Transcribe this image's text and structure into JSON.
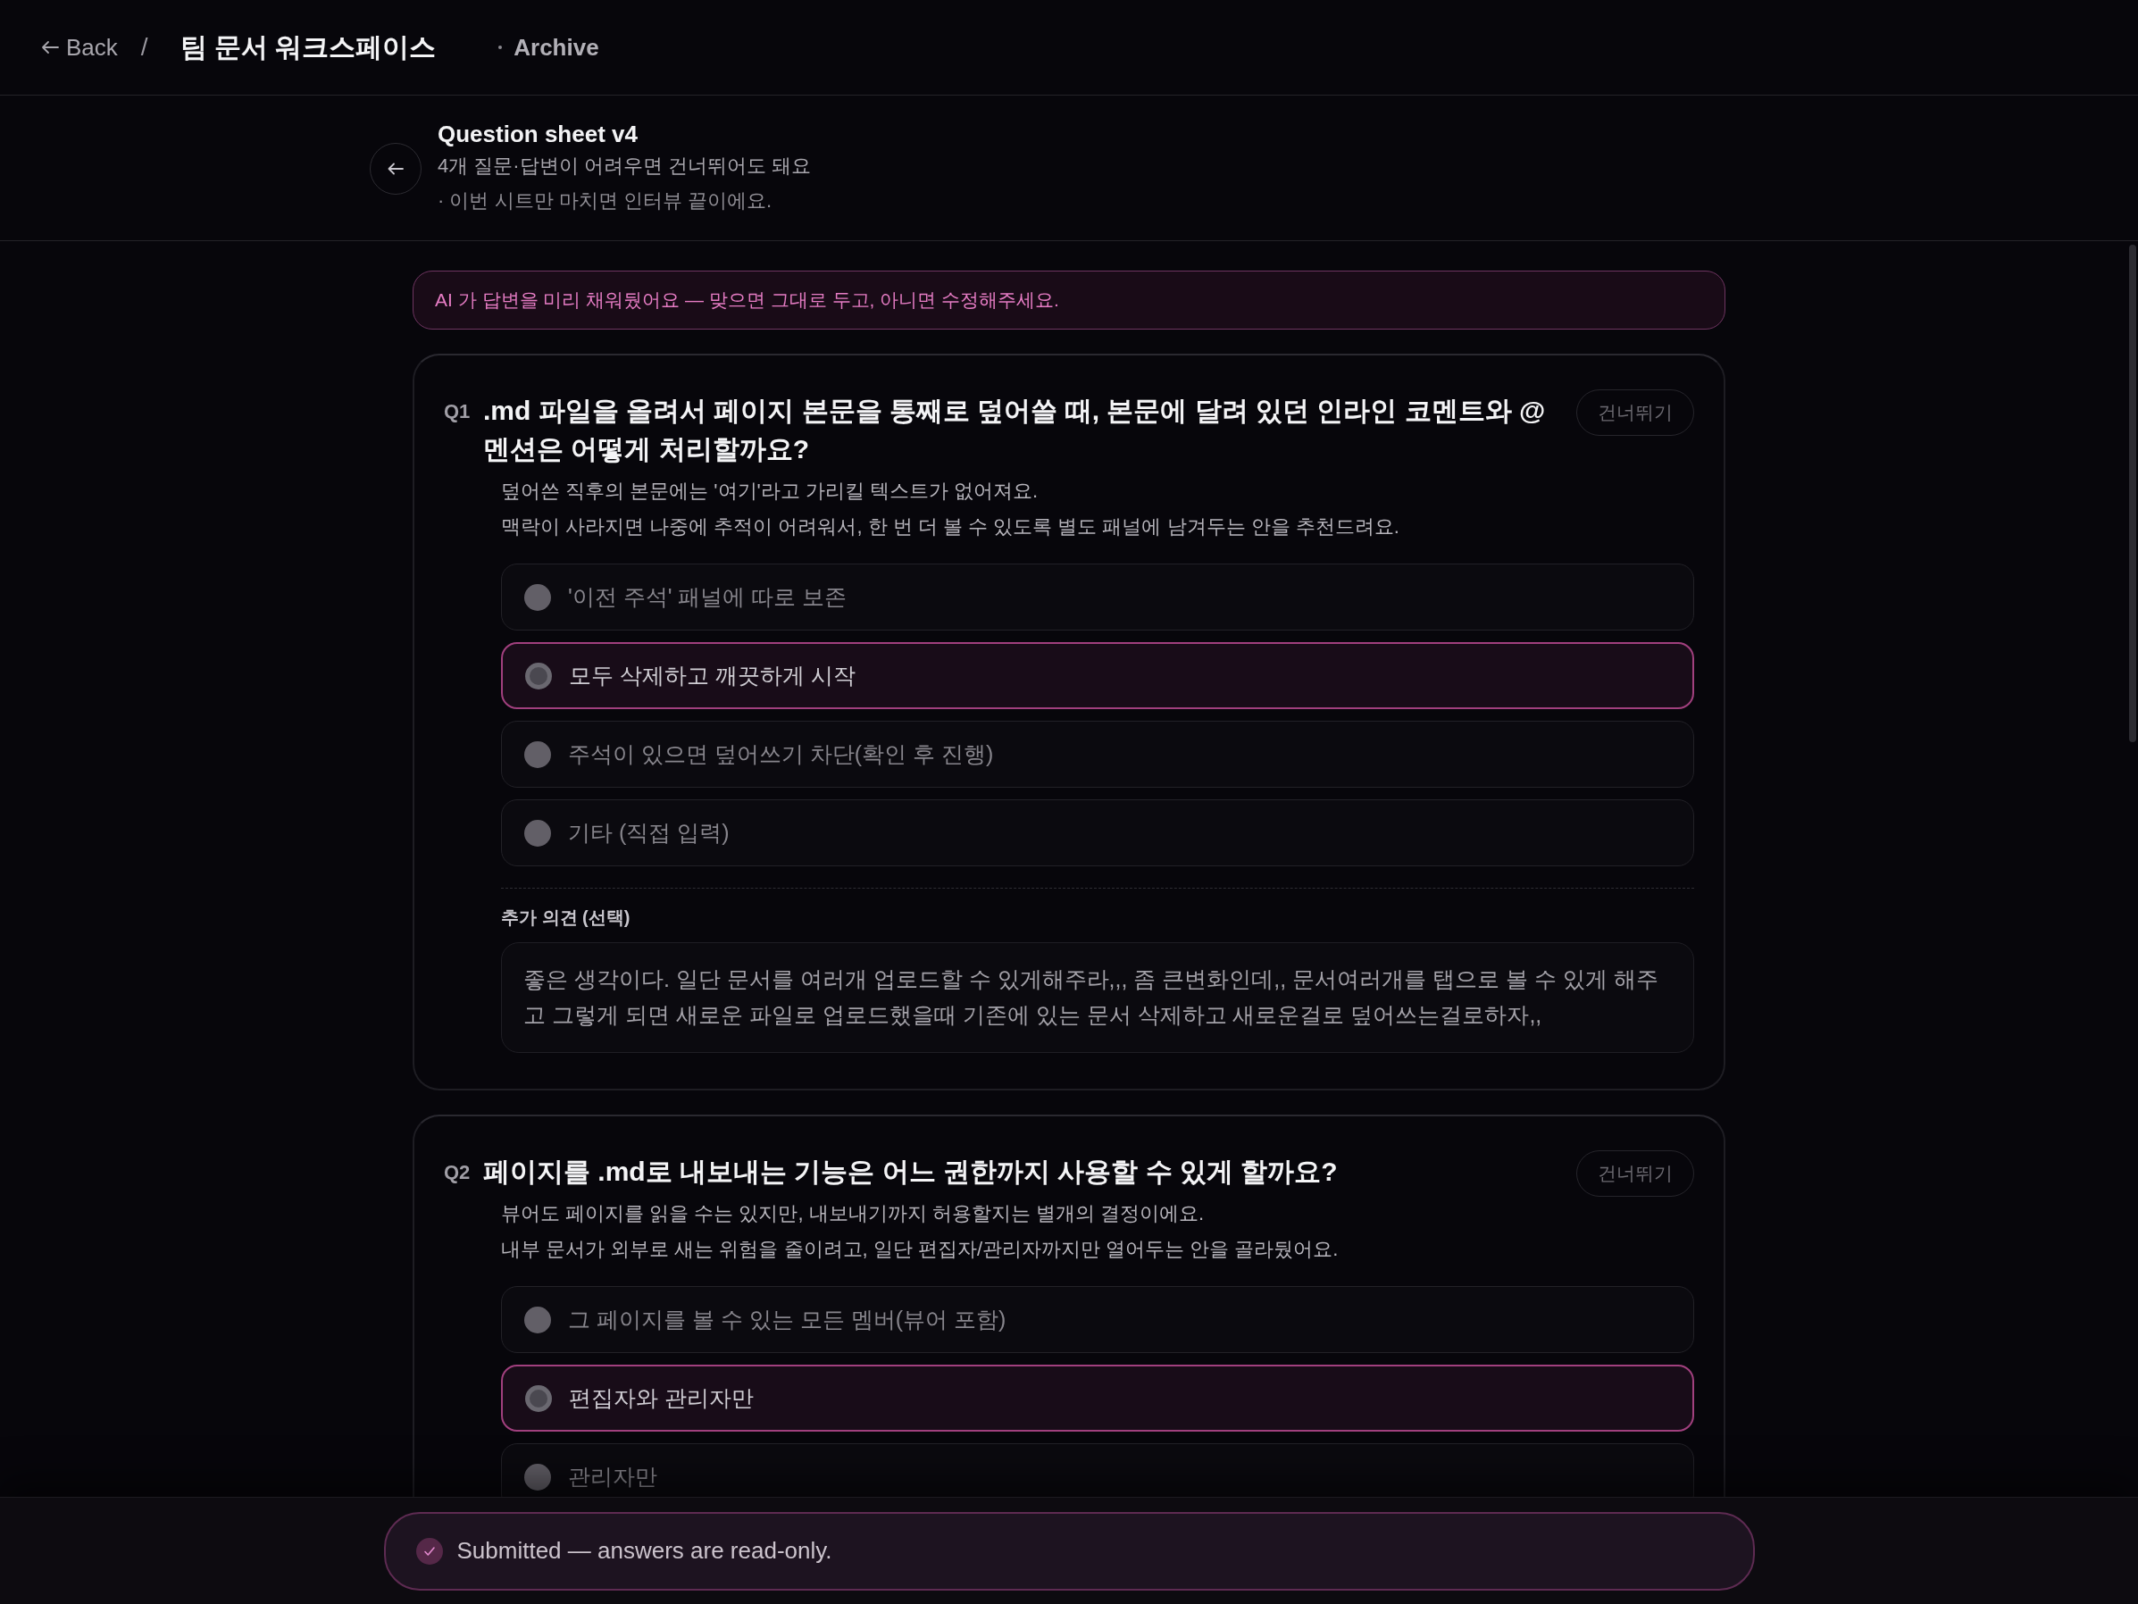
{
  "topbar": {
    "back": "Back",
    "separator": "/",
    "workspace": "팀 문서 워크스페이스",
    "archive": "Archive"
  },
  "sheet": {
    "title": "Question sheet v4",
    "subtitle": "4개 질문·답변이 어려우면 건너뛰어도 돼요",
    "note": "· 이번 시트만 마치면 인터뷰 끝이에요."
  },
  "notice": "AI 가 답변을 미리 채워뒀어요 — 맞으면 그대로 두고, 아니면 수정해주세요.",
  "questions": [
    {
      "number": "Q1",
      "title": ".md 파일을 올려서 페이지 본문을 통째로 덮어쓸 때, 본문에 달려 있던 인라인 코멘트와 @멘션은 어떻게 처리할까요?",
      "skip": "건너뛰기",
      "description": [
        "덮어쓴 직후의 본문에는 '여기'라고 가리킬 텍스트가 없어져요.",
        "맥락이 사라지면 나중에 추적이 어려워서, 한 번 더 볼 수 있도록 별도 패널에 남겨두는 안을 추천드려요."
      ],
      "options": [
        {
          "label": "'이전 주석' 패널에 따로 보존",
          "selected": false
        },
        {
          "label": "모두 삭제하고 깨끗하게 시작",
          "selected": true
        },
        {
          "label": "주석이 있으면 덮어쓰기 차단(확인 후 진행)",
          "selected": false
        },
        {
          "label": "기타 (직접 입력)",
          "selected": false
        }
      ],
      "comment": {
        "label": "추가 의견 (선택)",
        "value": "좋은 생각이다. 일단 문서를 여러개 업로드할 수 있게해주라,,, 좀 큰변화인데,, 문서여러개를 탭으로 볼 수 있게 해주고 그렇게 되면 새로운 파일로 업로드했을때 기존에 있는 문서 삭제하고 새로운걸로 덮어쓰는걸로하자,,"
      }
    },
    {
      "number": "Q2",
      "title": "페이지를 .md로 내보내는 기능은 어느 권한까지 사용할 수 있게 할까요?",
      "skip": "건너뛰기",
      "description": [
        "뷰어도 페이지를 읽을 수는 있지만, 내보내기까지 허용할지는 별개의 결정이에요.",
        "내부 문서가 외부로 새는 위험을 줄이려고, 일단 편집자/관리자까지만 열어두는 안을 골라뒀어요."
      ],
      "options": [
        {
          "label": "그 페이지를 볼 수 있는 모든 멤버(뷰어 포함)",
          "selected": false
        },
        {
          "label": "편집자와 관리자만",
          "selected": true
        },
        {
          "label": "관리자만",
          "selected": false
        }
      ]
    }
  ],
  "status": {
    "text": "Submitted — answers are read-only."
  }
}
